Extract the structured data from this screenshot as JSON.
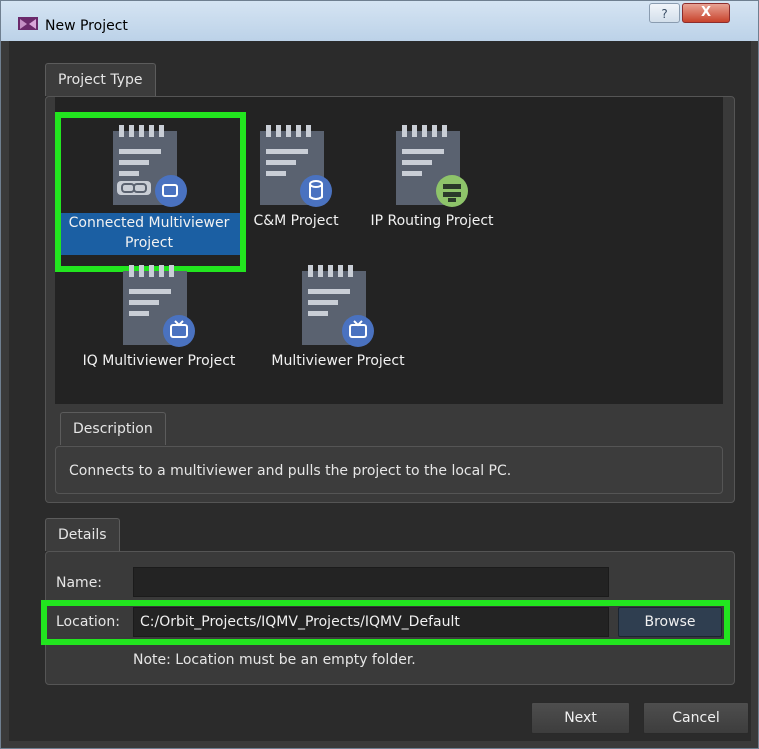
{
  "window": {
    "title": "New Project",
    "help_label": "?",
    "close_label": "X"
  },
  "project_type": {
    "tab_label": "Project Type",
    "items": [
      {
        "label": "Connected Multiviewer Project",
        "icon": "connected-multiviewer-icon",
        "selected": true
      },
      {
        "label": "C&M Project",
        "icon": "cm-project-icon",
        "selected": false
      },
      {
        "label": "IP Routing Project",
        "icon": "ip-routing-icon",
        "selected": false
      },
      {
        "label": "IQ Multiviewer Project",
        "icon": "iq-multiviewer-icon",
        "selected": false
      },
      {
        "label": "Multiviewer Project",
        "icon": "multiviewer-icon",
        "selected": false
      }
    ]
  },
  "description": {
    "tab_label": "Description",
    "text": "Connects to a multiviewer and pulls the project to the local PC."
  },
  "details": {
    "tab_label": "Details",
    "name_label": "Name:",
    "name_value": "",
    "location_label": "Location:",
    "location_value": "C:/Orbit_Projects/IQMV_Projects/IQMV_Default",
    "browse_label": "Browse",
    "note": "Note: Location must be an empty folder."
  },
  "footer": {
    "next_label": "Next",
    "cancel_label": "Cancel"
  },
  "colors": {
    "highlight": "#22e51f",
    "selection": "#1b5fa3",
    "badge_blue": "#4a72c0",
    "badge_green": "#8ec46a"
  }
}
